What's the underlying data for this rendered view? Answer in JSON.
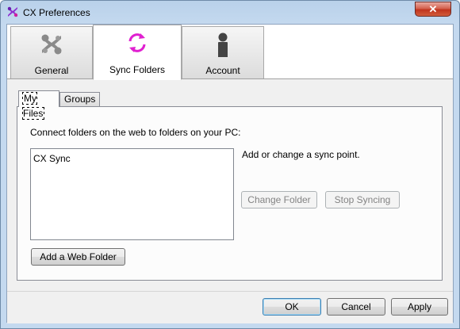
{
  "window": {
    "title": "CX Preferences",
    "close_symbol": "✕",
    "app_icon": "cx-logo-icon"
  },
  "toolbar": {
    "tabs": [
      {
        "label": "General",
        "icon": "cx-gray-logo-icon"
      },
      {
        "label": "Sync Folders",
        "icon": "sync-arrows-icon",
        "selected": true
      },
      {
        "label": "Account",
        "icon": "person-icon"
      }
    ]
  },
  "subtabs": [
    {
      "label": "My Files",
      "selected": true
    },
    {
      "label": "Groups"
    }
  ],
  "my_files": {
    "instruction": "Connect folders on the web to folders on your PC:",
    "sync_points": [
      "CX Sync"
    ],
    "hint": "Add or change a sync point.",
    "change_folder": "Change Folder",
    "stop_syncing": "Stop Syncing",
    "add_web_folder": "Add a Web Folder"
  },
  "footer": {
    "ok": "OK",
    "cancel": "Cancel",
    "apply": "Apply"
  },
  "colors": {
    "accent_magenta": "#e020d0",
    "logo_purple": "#7b2fbe",
    "close_red": "#c0341e"
  }
}
